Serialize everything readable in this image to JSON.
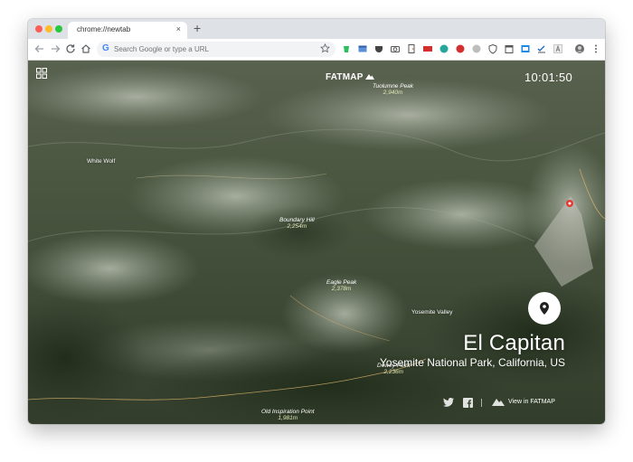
{
  "browser": {
    "tab_title": "chrome://newtab",
    "tab_close": "×",
    "new_tab": "+",
    "omnibox_placeholder": "Search Google or type a URL",
    "google_letter": "G"
  },
  "map": {
    "logo": "FATMAP",
    "clock": "10:01:50",
    "labels": [
      {
        "name": "Tuolumne Peak",
        "elev": "2,940m"
      },
      {
        "name": "Boundary Hill",
        "elev": "2,254m"
      },
      {
        "name": "Eagle Peak",
        "elev": "2,378m"
      },
      {
        "name": "Dewey Point",
        "elev": "2,236m"
      },
      {
        "name": "Old Inspiration Point",
        "elev": "1,981m"
      }
    ],
    "places": [
      "White Wolf",
      "Yosemite Valley"
    ],
    "location_title": "El Capitan",
    "location_subtitle": "Yosemite National Park, California, US",
    "view_link": "View in FATMAP"
  },
  "colors": {
    "accent_pin": "#e53935",
    "terrain_dark": "#3c4a32",
    "terrain_light": "#8e9a86"
  }
}
